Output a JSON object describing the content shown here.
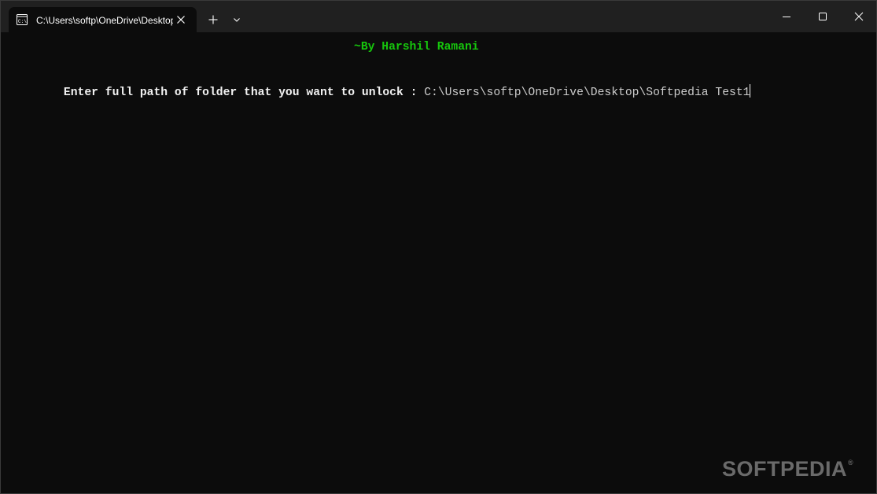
{
  "tab": {
    "title": "C:\\Users\\softp\\OneDrive\\Desktop",
    "icon": "terminal-icon"
  },
  "titlebar": {
    "new_tab_icon": "plus-icon",
    "dropdown_icon": "chevron-down-icon",
    "minimize_icon": "minimize-icon",
    "maximize_icon": "maximize-icon",
    "close_icon": "close-icon"
  },
  "console": {
    "credit": "~By Harshil Ramani",
    "prompt_label": "Enter full path of folder that you want to unlock : ",
    "input_value": "C:\\Users\\softp\\OneDrive\\Desktop\\Softpedia Test1"
  },
  "watermark": {
    "text": "SOFTPEDIA",
    "mark": "®"
  },
  "colors": {
    "background": "#0c0c0c",
    "titlebar": "#202020",
    "credit": "#16c60c",
    "text": "#f2f2f2"
  }
}
